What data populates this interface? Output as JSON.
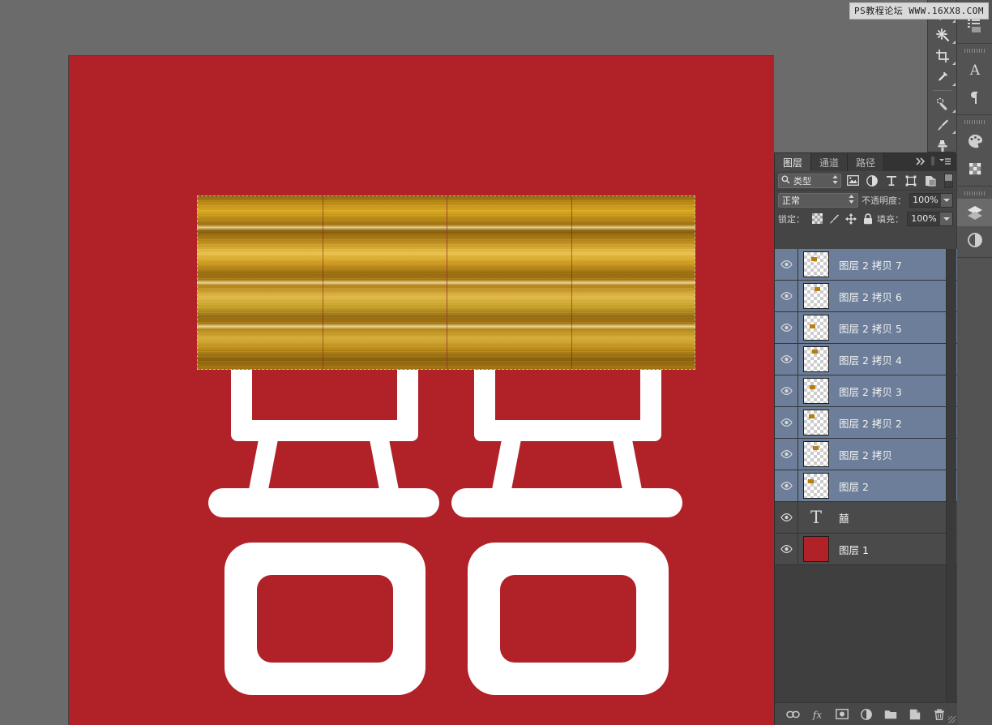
{
  "watermark": {
    "text": "PS教程论坛  WWW.16XX8.COM"
  },
  "canvas": {
    "background_color": "#b02128",
    "glyph_text": "囍",
    "glyph_color": "#ffffff",
    "gold_texture_label": "gold-gradient-fill"
  },
  "toolbar": {
    "tools": [
      {
        "name": "lasso-tool-icon",
        "label": "套索工具"
      },
      {
        "name": "magic-wand-tool-icon",
        "label": "魔棒工具"
      },
      {
        "name": "crop-tool-icon",
        "label": "裁剪工具"
      },
      {
        "name": "eyedropper-tool-icon",
        "label": "吸管工具"
      },
      {
        "name": "healing-brush-tool-icon",
        "label": "污点修复画笔工具"
      },
      {
        "name": "brush-tool-icon",
        "label": "画笔工具"
      },
      {
        "name": "clone-stamp-tool-icon",
        "label": "仿制图章工具"
      }
    ]
  },
  "rail": {
    "groups": [
      {
        "items": [
          {
            "name": "history-panel-icon"
          }
        ]
      },
      {
        "items": [
          {
            "name": "character-panel-icon"
          },
          {
            "name": "paragraph-panel-icon"
          }
        ]
      },
      {
        "items": [
          {
            "name": "color-panel-icon"
          },
          {
            "name": "swatches-panel-icon"
          }
        ]
      },
      {
        "items": [
          {
            "name": "layers-panel-icon"
          },
          {
            "name": "channels-panel-icon"
          }
        ]
      }
    ]
  },
  "panel": {
    "tabs": [
      {
        "label": "图层",
        "active": true
      },
      {
        "label": "通道",
        "active": false
      },
      {
        "label": "路径",
        "active": false
      }
    ],
    "collapse_icon": "double-chevron-right-icon",
    "menu_icon": "panel-menu-icon",
    "filter": {
      "search_icon": "search-icon",
      "type_label": "类型",
      "stepper_icon": "stepper-arrows-icon",
      "kind_icons": [
        {
          "name": "filter-pixel-layers-icon"
        },
        {
          "name": "filter-adjustment-layers-icon"
        },
        {
          "name": "filter-type-layers-icon"
        },
        {
          "name": "filter-shape-layers-icon"
        },
        {
          "name": "filter-smart-object-layers-icon"
        }
      ],
      "power_toggle": "filter-enable-toggle"
    },
    "blend_mode": "正常",
    "opacity_label": "不透明度：",
    "opacity_value": "100%",
    "lock_label": "锁定：",
    "lock_icons": [
      {
        "name": "lock-transparent-pixels-icon"
      },
      {
        "name": "lock-image-pixels-icon"
      },
      {
        "name": "lock-position-icon"
      },
      {
        "name": "lock-all-icon"
      }
    ],
    "fill_label": "填充：",
    "fill_value": "100%",
    "layers": [
      {
        "name": "图层 2 拷贝 7",
        "selected": true,
        "thumb": "transparent",
        "eye": true
      },
      {
        "name": "图层 2 拷贝 6",
        "selected": true,
        "thumb": "transparent",
        "eye": true
      },
      {
        "name": "图层 2 拷贝 5",
        "selected": true,
        "thumb": "transparent",
        "eye": true
      },
      {
        "name": "图层 2 拷贝 4",
        "selected": true,
        "thumb": "transparent",
        "eye": true
      },
      {
        "name": "图层 2 拷贝 3",
        "selected": true,
        "thumb": "transparent",
        "eye": true
      },
      {
        "name": "图层 2 拷贝 2",
        "selected": true,
        "thumb": "transparent",
        "eye": true
      },
      {
        "name": "图层 2 拷贝",
        "selected": true,
        "thumb": "transparent",
        "eye": true
      },
      {
        "name": "图层 2",
        "selected": true,
        "thumb": "transparent",
        "eye": true
      },
      {
        "name": "囍",
        "selected": false,
        "thumb": "type",
        "eye": true,
        "type_glyph": "T"
      },
      {
        "name": "图层 1",
        "selected": false,
        "thumb": "solid",
        "eye": true
      }
    ],
    "footer_buttons": [
      {
        "name": "link-layers-button"
      },
      {
        "name": "layer-style-fx-button"
      },
      {
        "name": "add-layer-mask-button"
      },
      {
        "name": "new-adjustment-layer-button"
      },
      {
        "name": "new-group-button"
      },
      {
        "name": "new-layer-button"
      },
      {
        "name": "delete-layer-button"
      }
    ]
  },
  "colors": {
    "canvas_red": "#b02128",
    "selection_blue": "#6c7e99",
    "panel_bg": "#454545",
    "gold_light": "#f0c64a",
    "gold_dark": "#8a5f06"
  }
}
